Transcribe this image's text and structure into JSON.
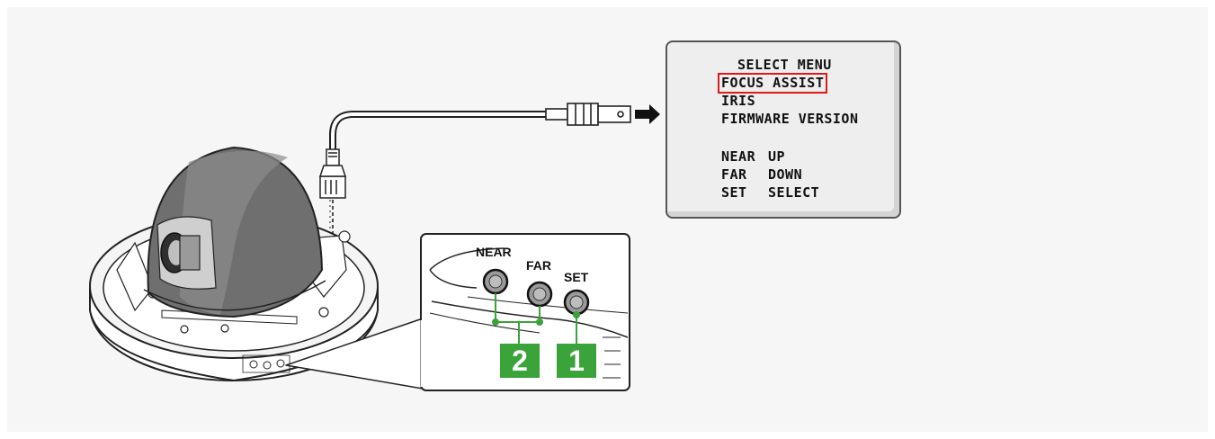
{
  "menu": {
    "title": "SELECT MENU",
    "items": [
      "FOCUS ASSIST",
      "IRIS",
      "FIRMWARE VERSION"
    ],
    "selected_index": 0,
    "controls": [
      {
        "key": "NEAR",
        "action": "UP"
      },
      {
        "key": "FAR",
        "action": "DOWN"
      },
      {
        "key": "SET",
        "action": "SELECT"
      }
    ]
  },
  "buttons": {
    "near": "NEAR",
    "far": "FAR",
    "set": "SET"
  },
  "steps": {
    "near_far": "2",
    "set": "1"
  },
  "colors": {
    "panel_bg": "#f6f6f6",
    "highlight": "#e01a1a",
    "step_green": "#3aa33a",
    "dome_gray": "#6f6f6f",
    "line": "#222222"
  }
}
